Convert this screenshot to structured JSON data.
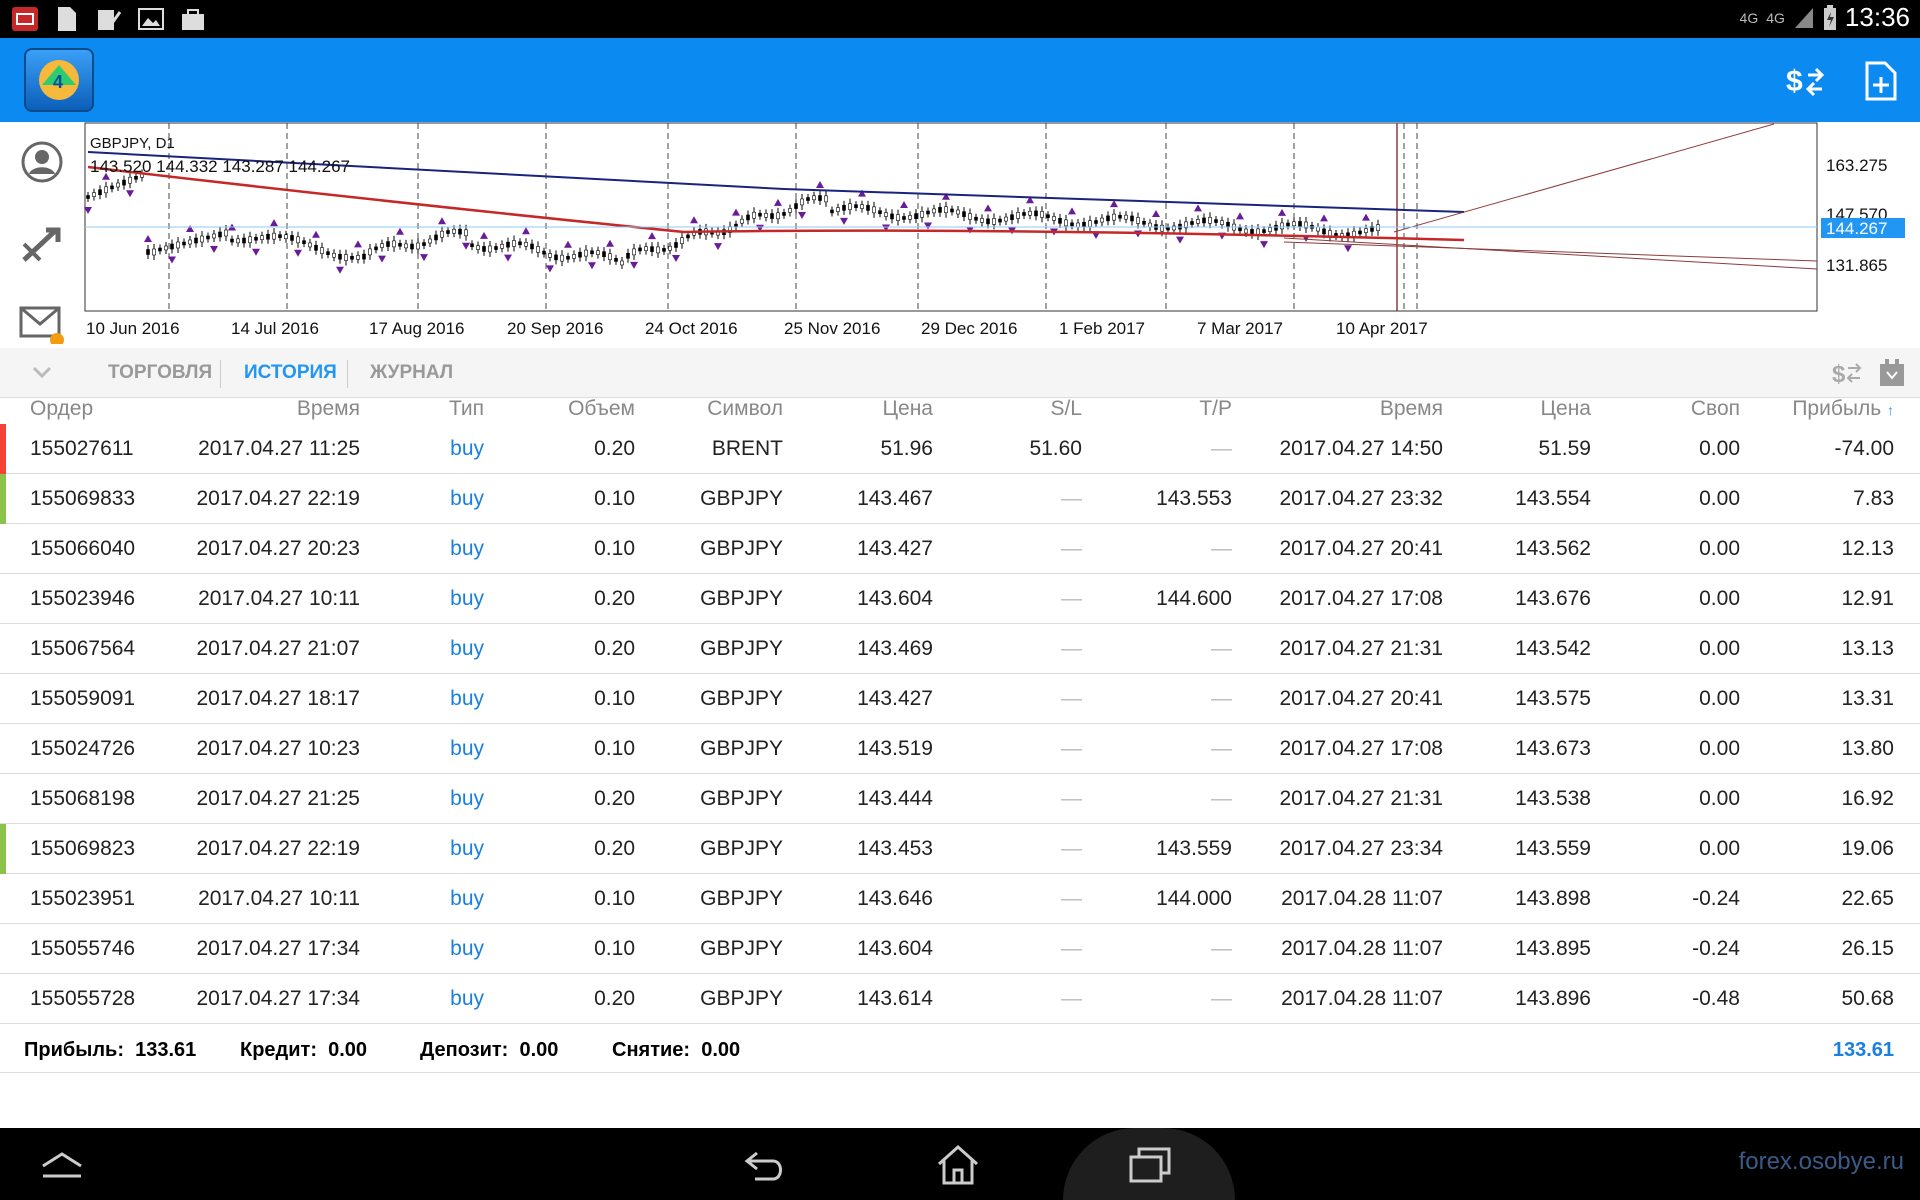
{
  "status_bar": {
    "time": "13:36",
    "net_label": "4G"
  },
  "chart": {
    "symbol_label": "GBPJPY, D1",
    "ohlc_label": "143.520 144.332 143.287 144.267",
    "price_ticks": [
      "163.275",
      "147.570",
      "131.865"
    ],
    "current_price": "144.267",
    "date_ticks": [
      "10 Jun 2016",
      "14 Jul 2016",
      "17 Aug 2016",
      "20 Sep 2016",
      "24 Oct 2016",
      "25 Nov 2016",
      "29 Dec 2016",
      "1 Feb 2017",
      "7 Mar 2017",
      "10 Apr 2017"
    ],
    "colors": {
      "ma_slow": "#1a237e",
      "ma_fast": "#c62828",
      "fractal": "#6a1b9a",
      "accent": "#2196f3"
    }
  },
  "tabs": [
    {
      "label": "ТОРГОВЛЯ"
    },
    {
      "label": "ИСТОРИЯ"
    },
    {
      "label": "ЖУРНАЛ"
    }
  ],
  "columns": [
    "Ордер",
    "Время",
    "Тип",
    "Объем",
    "Символ",
    "Цена",
    "S/L",
    "T/P",
    "Время",
    "Цена",
    "Своп",
    "Прибыль"
  ],
  "rows": [
    {
      "order": "155027611",
      "time": "2017.04.27 11:25",
      "type": "buy",
      "volume": "0.20",
      "symbol": "BRENT",
      "price": "51.96",
      "sl": "51.60",
      "tp": "—",
      "close_time": "2017.04.27 14:50",
      "close_price": "51.59",
      "swap": "0.00",
      "profit": "-74.00",
      "marker": "#f44336"
    },
    {
      "order": "155069833",
      "time": "2017.04.27 22:19",
      "type": "buy",
      "volume": "0.10",
      "symbol": "GBPJPY",
      "price": "143.467",
      "sl": "—",
      "tp": "143.553",
      "close_time": "2017.04.27 23:32",
      "close_price": "143.554",
      "swap": "0.00",
      "profit": "7.83",
      "marker": "#8bc34a"
    },
    {
      "order": "155066040",
      "time": "2017.04.27 20:23",
      "type": "buy",
      "volume": "0.10",
      "symbol": "GBPJPY",
      "price": "143.427",
      "sl": "—",
      "tp": "—",
      "close_time": "2017.04.27 20:41",
      "close_price": "143.562",
      "swap": "0.00",
      "profit": "12.13",
      "marker": ""
    },
    {
      "order": "155023946",
      "time": "2017.04.27 10:11",
      "type": "buy",
      "volume": "0.20",
      "symbol": "GBPJPY",
      "price": "143.604",
      "sl": "—",
      "tp": "144.600",
      "close_time": "2017.04.27 17:08",
      "close_price": "143.676",
      "swap": "0.00",
      "profit": "12.91",
      "marker": ""
    },
    {
      "order": "155067564",
      "time": "2017.04.27 21:07",
      "type": "buy",
      "volume": "0.20",
      "symbol": "GBPJPY",
      "price": "143.469",
      "sl": "—",
      "tp": "—",
      "close_time": "2017.04.27 21:31",
      "close_price": "143.542",
      "swap": "0.00",
      "profit": "13.13",
      "marker": ""
    },
    {
      "order": "155059091",
      "time": "2017.04.27 18:17",
      "type": "buy",
      "volume": "0.10",
      "symbol": "GBPJPY",
      "price": "143.427",
      "sl": "—",
      "tp": "—",
      "close_time": "2017.04.27 20:41",
      "close_price": "143.575",
      "swap": "0.00",
      "profit": "13.31",
      "marker": ""
    },
    {
      "order": "155024726",
      "time": "2017.04.27 10:23",
      "type": "buy",
      "volume": "0.10",
      "symbol": "GBPJPY",
      "price": "143.519",
      "sl": "—",
      "tp": "—",
      "close_time": "2017.04.27 17:08",
      "close_price": "143.673",
      "swap": "0.00",
      "profit": "13.80",
      "marker": ""
    },
    {
      "order": "155068198",
      "time": "2017.04.27 21:25",
      "type": "buy",
      "volume": "0.20",
      "symbol": "GBPJPY",
      "price": "143.444",
      "sl": "—",
      "tp": "—",
      "close_time": "2017.04.27 21:31",
      "close_price": "143.538",
      "swap": "0.00",
      "profit": "16.92",
      "marker": ""
    },
    {
      "order": "155069823",
      "time": "2017.04.27 22:19",
      "type": "buy",
      "volume": "0.20",
      "symbol": "GBPJPY",
      "price": "143.453",
      "sl": "—",
      "tp": "143.559",
      "close_time": "2017.04.27 23:34",
      "close_price": "143.559",
      "swap": "0.00",
      "profit": "19.06",
      "marker": "#8bc34a"
    },
    {
      "order": "155023951",
      "time": "2017.04.27 10:11",
      "type": "buy",
      "volume": "0.10",
      "symbol": "GBPJPY",
      "price": "143.646",
      "sl": "—",
      "tp": "144.000",
      "close_time": "2017.04.28 11:07",
      "close_price": "143.898",
      "swap": "-0.24",
      "profit": "22.65",
      "marker": ""
    },
    {
      "order": "155055746",
      "time": "2017.04.27 17:34",
      "type": "buy",
      "volume": "0.10",
      "symbol": "GBPJPY",
      "price": "143.604",
      "sl": "—",
      "tp": "—",
      "close_time": "2017.04.28 11:07",
      "close_price": "143.895",
      "swap": "-0.24",
      "profit": "26.15",
      "marker": ""
    },
    {
      "order": "155055728",
      "time": "2017.04.27 17:34",
      "type": "buy",
      "volume": "0.20",
      "symbol": "GBPJPY",
      "price": "143.614",
      "sl": "—",
      "tp": "—",
      "close_time": "2017.04.28 11:07",
      "close_price": "143.896",
      "swap": "-0.48",
      "profit": "50.68",
      "marker": ""
    }
  ],
  "summary": {
    "profit_label": "Прибыль:",
    "profit_value": "133.61",
    "credit_label": "Кредит:",
    "credit_value": "0.00",
    "deposit_label": "Депозит:",
    "deposit_value": "0.00",
    "withdrawal_label": "Снятие:",
    "withdrawal_value": "0.00",
    "total": "133.61"
  },
  "watermark": "forex.osobye.ru"
}
